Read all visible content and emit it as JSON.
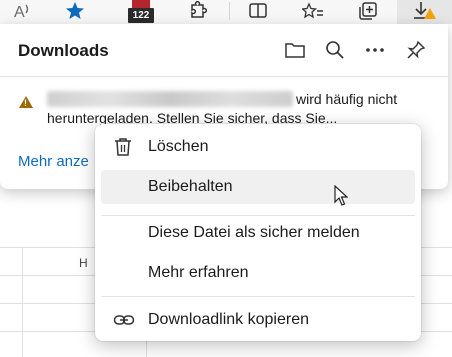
{
  "toolbar": {
    "icons": [
      "read-aloud-icon",
      "favorite-star-icon",
      "extension-icon",
      "puzzle-icon",
      "split-screen-icon",
      "favorites-list-icon",
      "collections-icon",
      "downloads-icon"
    ],
    "extension_badge": "122",
    "accent_color": "#0f6cbd"
  },
  "downloads_panel": {
    "title": "Downloads",
    "actions": [
      "folder-icon",
      "search-icon",
      "more-icon",
      "pin-icon"
    ],
    "item": {
      "warning_text_line1": "wird häufig nicht",
      "warning_text_line2": "heruntergeladen. Stellen Sie sicher, dass Sie..."
    },
    "more_link": "Mehr anze"
  },
  "context_menu": {
    "items": [
      {
        "label": "Löschen",
        "icon": "trash-icon"
      },
      {
        "label": "Beibehalten",
        "icon": ""
      },
      {
        "label": "Diese Datei als sicher melden",
        "icon": ""
      },
      {
        "label": "Mehr erfahren",
        "icon": ""
      },
      {
        "label": "Downloadlink kopieren",
        "icon": "link-icon"
      }
    ],
    "hovered_item": "Beibehalten"
  },
  "sheet": {
    "column_header": "H"
  }
}
